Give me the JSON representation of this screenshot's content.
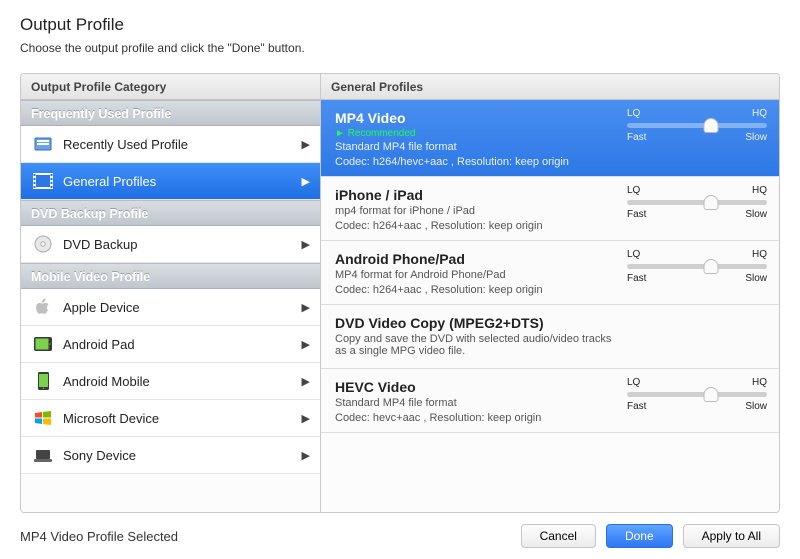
{
  "header": {
    "title": "Output Profile",
    "subtitle": "Choose the output profile and click the \"Done\" button."
  },
  "leftHeader": "Output Profile Category",
  "rightHeader": "General Profiles",
  "groups": [
    {
      "label": "Frequently Used Profile",
      "items": [
        {
          "key": "recent",
          "label": "Recently Used Profile",
          "icon": "recent"
        },
        {
          "key": "general",
          "label": "General Profiles",
          "icon": "film",
          "selected": true
        }
      ]
    },
    {
      "label": "DVD Backup Profile",
      "items": [
        {
          "key": "dvdbk",
          "label": "DVD Backup",
          "icon": "disc"
        }
      ]
    },
    {
      "label": "Mobile Video Profile",
      "items": [
        {
          "key": "apple",
          "label": "Apple Device",
          "icon": "apple"
        },
        {
          "key": "apad",
          "label": "Android Pad",
          "icon": "tablet"
        },
        {
          "key": "amob",
          "label": "Android Mobile",
          "icon": "phone"
        },
        {
          "key": "ms",
          "label": "Microsoft Device",
          "icon": "windows"
        },
        {
          "key": "sony",
          "label": "Sony Device",
          "icon": "sony"
        }
      ]
    }
  ],
  "profiles": [
    {
      "title": "MP4 Video",
      "rec": "► Recommended",
      "sub": "Standard MP4 file format",
      "sub2": "Codec: h264/hevc+aac , Resolution: keep origin",
      "selected": true,
      "slider": true,
      "lq": "LQ",
      "hq": "HQ",
      "fast": "Fast",
      "slow": "Slow"
    },
    {
      "title": "iPhone / iPad",
      "sub": "mp4 format for iPhone / iPad",
      "sub2": "Codec: h264+aac , Resolution: keep origin",
      "slider": true,
      "lq": "LQ",
      "hq": "HQ",
      "fast": "Fast",
      "slow": "Slow"
    },
    {
      "title": "Android Phone/Pad",
      "sub": "MP4 format for Android Phone/Pad",
      "sub2": "Codec: h264+aac , Resolution: keep origin",
      "slider": true,
      "lq": "LQ",
      "hq": "HQ",
      "fast": "Fast",
      "slow": "Slow"
    },
    {
      "title": "DVD Video Copy (MPEG2+DTS)",
      "sub": "Copy and save the DVD with selected audio/video tracks\n as a single MPG video file.",
      "slider": false
    },
    {
      "title": "HEVC Video",
      "sub": "Standard MP4 file format",
      "sub2": "Codec: hevc+aac , Resolution: keep origin",
      "slider": true,
      "lq": "LQ",
      "hq": "HQ",
      "fast": "Fast",
      "slow": "Slow"
    }
  ],
  "footer": {
    "status": "MP4 Video Profile Selected",
    "cancel": "Cancel",
    "done": "Done",
    "apply": "Apply to All"
  }
}
